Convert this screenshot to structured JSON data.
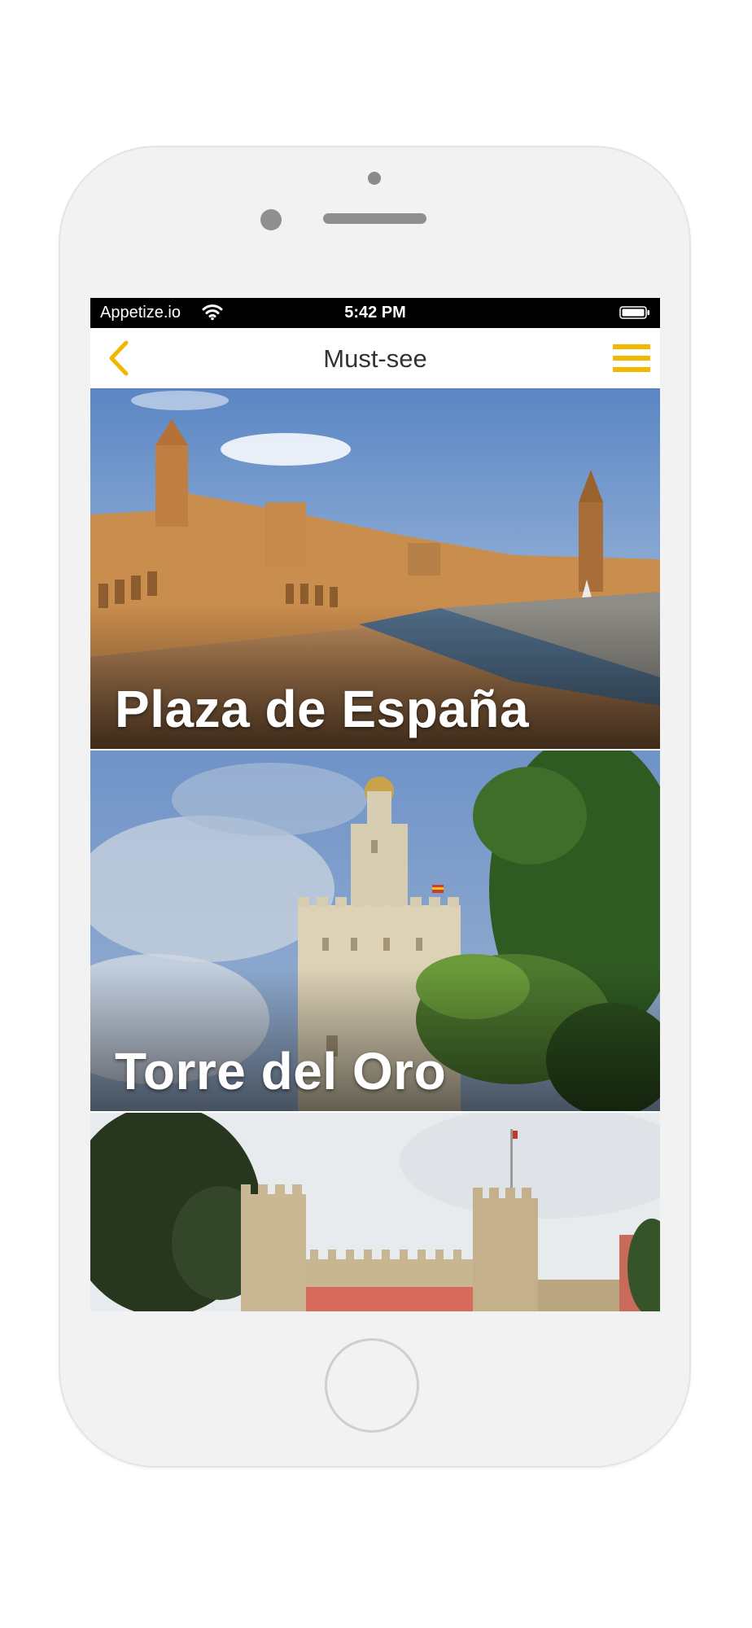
{
  "status_bar": {
    "carrier": "Appetize.io",
    "time": "5:42 PM"
  },
  "nav": {
    "title": "Must-see",
    "back_icon": "chevron-left-icon",
    "menu_icon": "hamburger-menu-icon",
    "accent_color": "#F2B800"
  },
  "places": [
    {
      "title": "Plaza de España"
    },
    {
      "title": "Torre del Oro"
    },
    {
      "title": ""
    }
  ]
}
